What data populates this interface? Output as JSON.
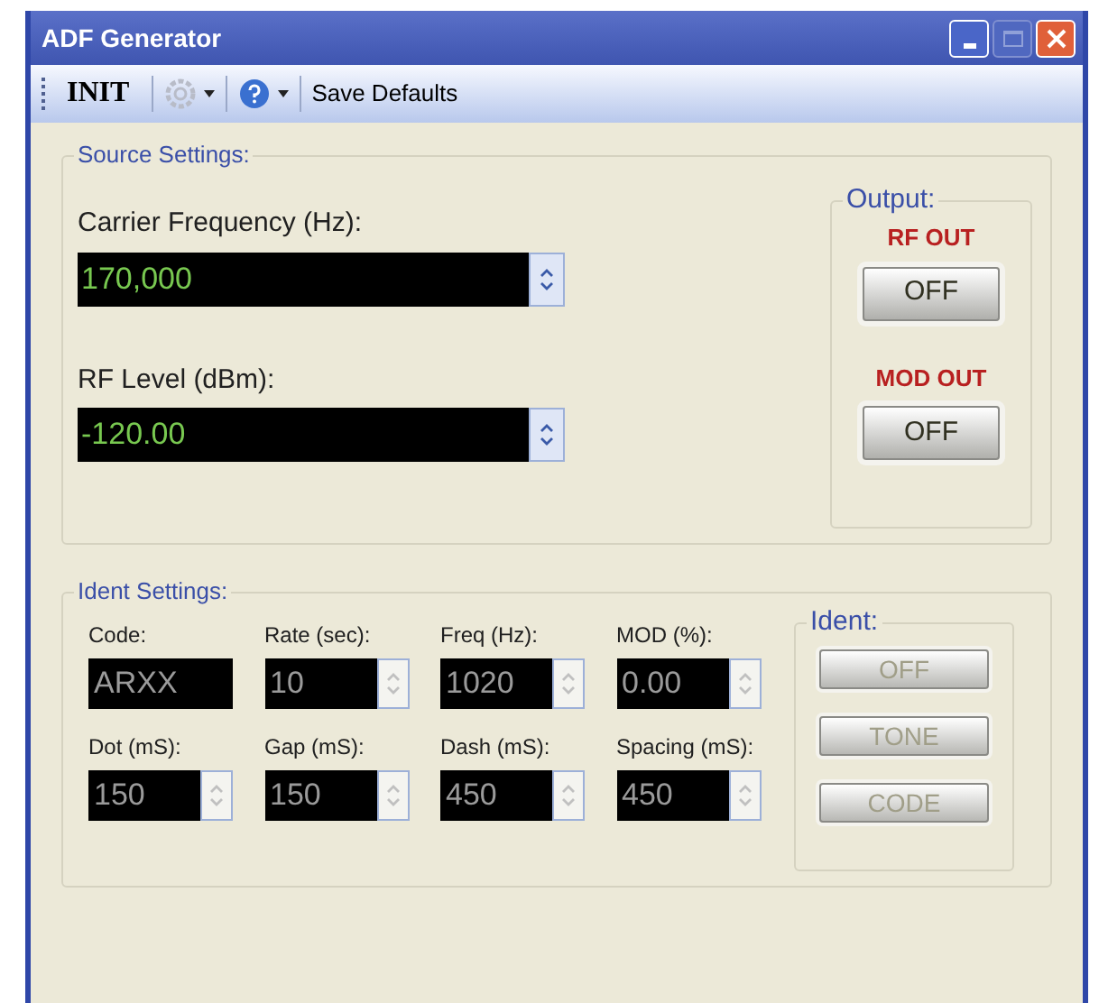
{
  "window": {
    "title": "ADF Generator"
  },
  "toolbar": {
    "init": "INIT",
    "save": "Save Defaults"
  },
  "source": {
    "title": "Source Settings:",
    "fields": [
      {
        "label": "Carrier Frequency (Hz):",
        "value": "170,000"
      },
      {
        "label": "RF Level (dBm):",
        "value": "-120.00"
      }
    ]
  },
  "output": {
    "title": "Output:",
    "channels": [
      {
        "label": "RF OUT",
        "button": "OFF"
      },
      {
        "label": "MOD OUT",
        "button": "OFF"
      }
    ]
  },
  "ident_settings": {
    "title": "Ident Settings:",
    "fields": [
      {
        "label": "Code:",
        "value": "ARXX",
        "kind": "text",
        "disabled": true
      },
      {
        "label": "Rate (sec):",
        "value": "10",
        "kind": "spin",
        "disabled": true
      },
      {
        "label": "Freq (Hz):",
        "value": "1020",
        "kind": "spin",
        "disabled": true
      },
      {
        "label": "MOD (%):",
        "value": "0.00",
        "kind": "spin",
        "disabled": true
      },
      {
        "label": "Dot (mS):",
        "value": "150",
        "kind": "spin",
        "disabled": true
      },
      {
        "label": "Gap (mS):",
        "value": "150",
        "kind": "spin",
        "disabled": true
      },
      {
        "label": "Dash (mS):",
        "value": "450",
        "kind": "spin",
        "disabled": true
      },
      {
        "label": "Spacing (mS):",
        "value": "450",
        "kind": "spin",
        "disabled": true
      }
    ]
  },
  "ident": {
    "title": "Ident:",
    "buttons": [
      {
        "label": "OFF",
        "disabled": true
      },
      {
        "label": "TONE",
        "disabled": true
      },
      {
        "label": "CODE",
        "disabled": true
      }
    ]
  }
}
